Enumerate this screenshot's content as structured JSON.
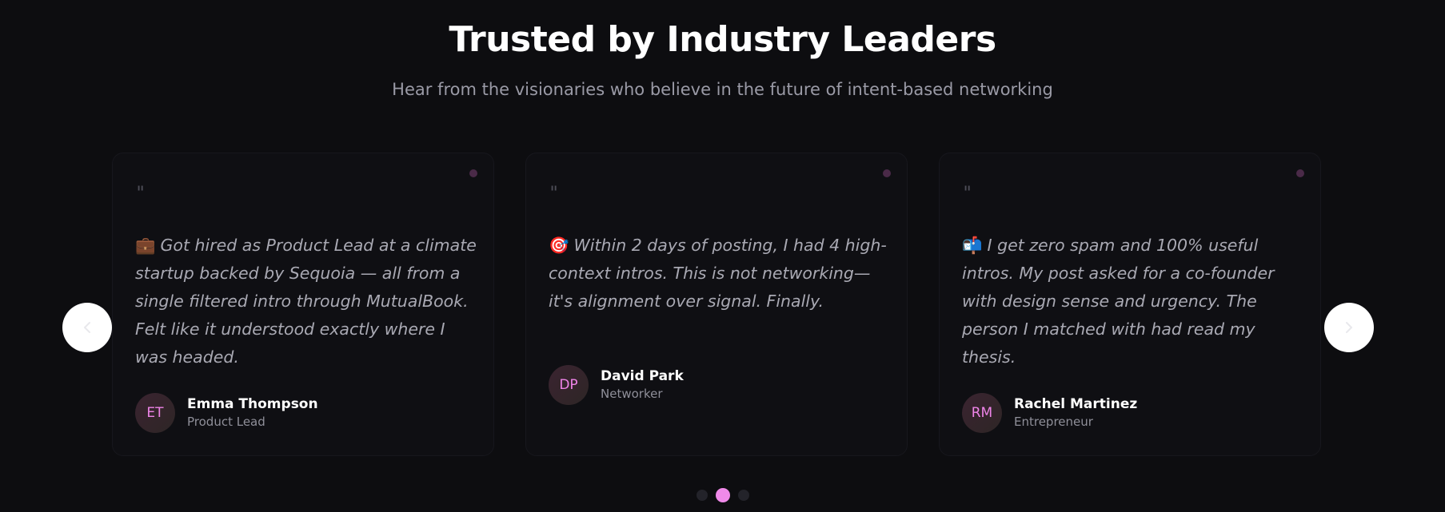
{
  "section": {
    "title": "Trusted by Industry Leaders",
    "subtitle": "Hear from the visionaries who believe in the future of intent-based networking"
  },
  "quote_mark": "\"",
  "testimonials": [
    {
      "emoji": "💼",
      "quote": "Got hired as Product Lead at a climate startup backed by Sequoia — all from a single filtered intro through MutualBook. Felt like it understood exactly where I was headed.",
      "initials": "ET",
      "name": "Emma Thompson",
      "role": "Product Lead"
    },
    {
      "emoji": "🎯",
      "quote": "Within 2 days of posting, I had 4 high-context intros. This is not networking—it's alignment over signal. Finally.",
      "initials": "DP",
      "name": "David Park",
      "role": "Networker"
    },
    {
      "emoji": "📬",
      "quote": "I get zero spam and 100% useful intros. My post asked for a co-founder with design sense and urgency. The person I matched with had read my thesis.",
      "initials": "RM",
      "name": "Rachel Martinez",
      "role": "Entrepreneur"
    }
  ],
  "carousel": {
    "prev_icon": "chevron-left-icon",
    "next_icon": "chevron-right-icon",
    "pages": 3,
    "active_page": 2
  },
  "colors": {
    "background": "#0d0d10",
    "accent": "#f08ae9",
    "card": "#0f0f13"
  }
}
